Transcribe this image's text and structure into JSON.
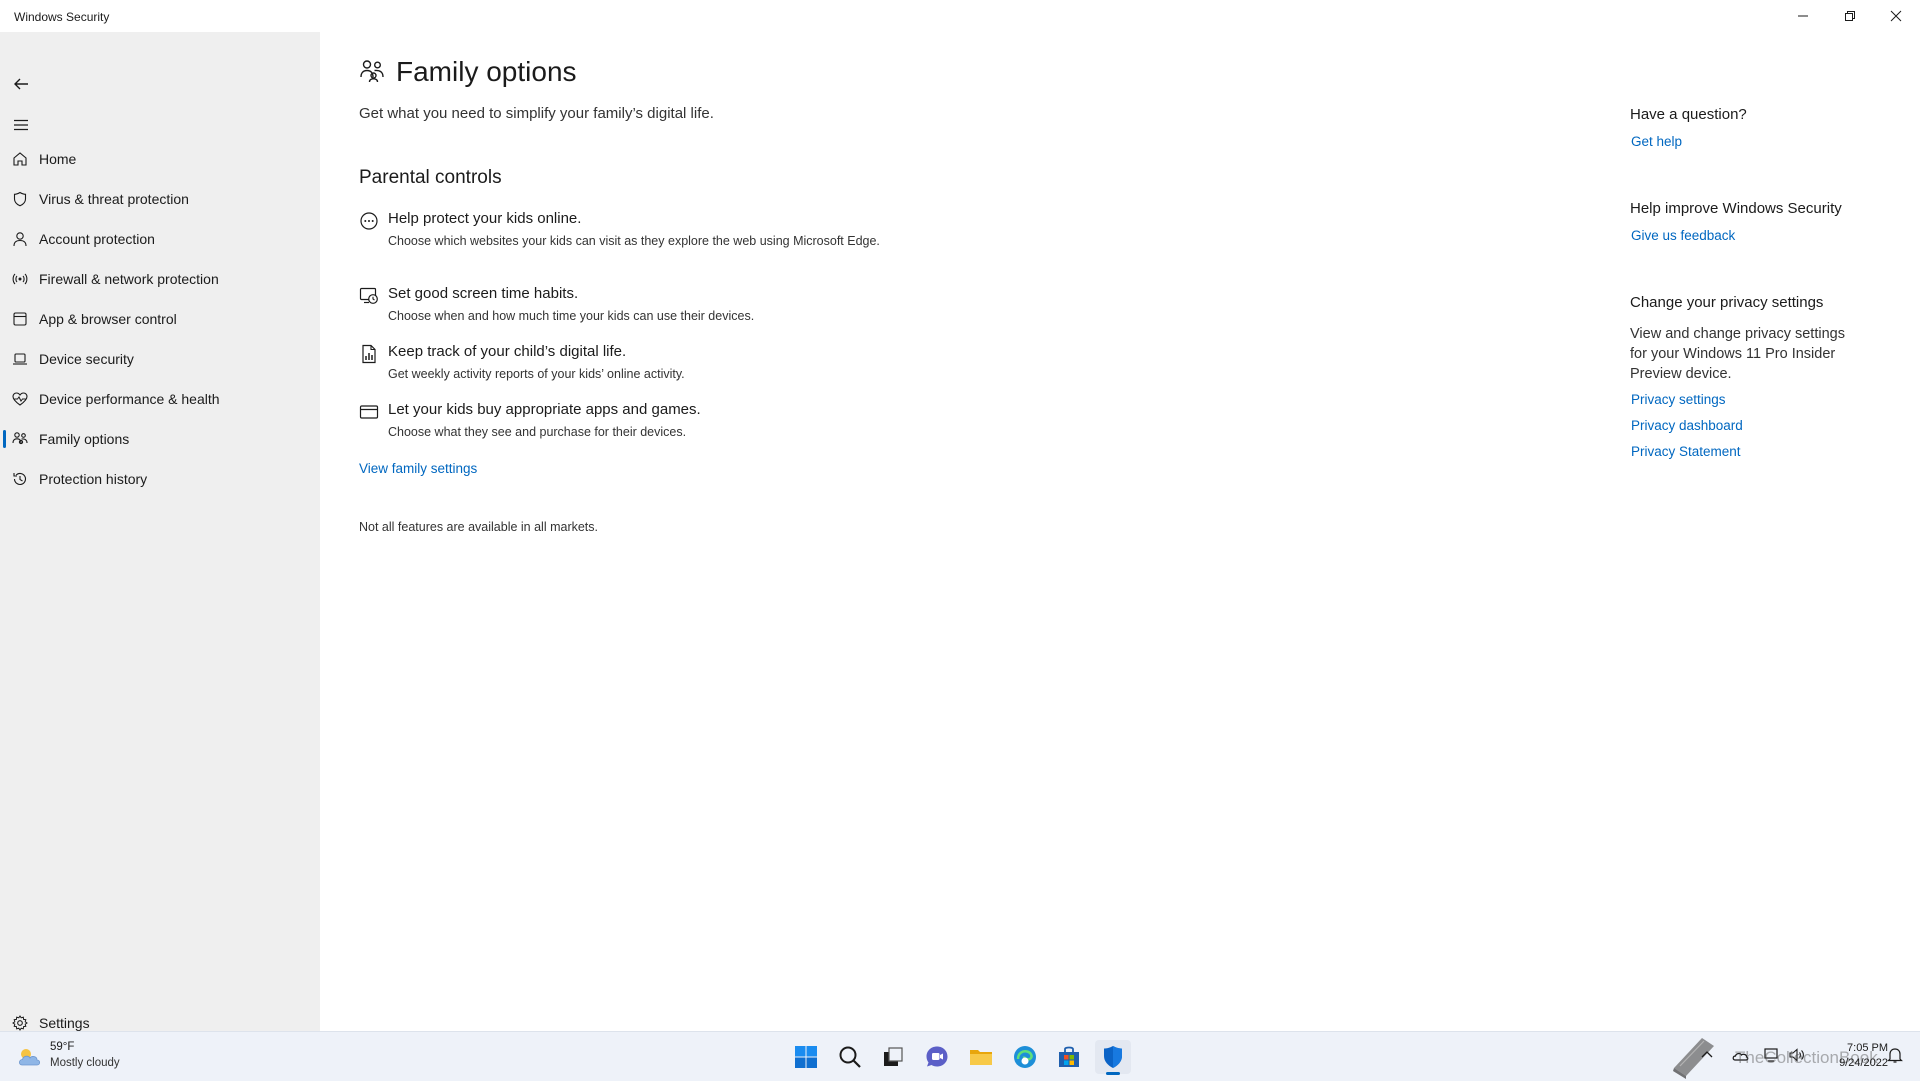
{
  "window": {
    "title": "Windows Security"
  },
  "sidebar": {
    "items": [
      {
        "label": "Home",
        "icon": "home-icon"
      },
      {
        "label": "Virus & threat protection",
        "icon": "shield-icon"
      },
      {
        "label": "Account protection",
        "icon": "person-icon"
      },
      {
        "label": "Firewall & network protection",
        "icon": "antenna-icon"
      },
      {
        "label": "App & browser control",
        "icon": "app-window-icon"
      },
      {
        "label": "Device security",
        "icon": "laptop-icon"
      },
      {
        "label": "Device performance & health",
        "icon": "heart-pulse-icon"
      },
      {
        "label": "Family options",
        "icon": "family-icon"
      },
      {
        "label": "Protection history",
        "icon": "history-icon"
      }
    ],
    "active_item": "Family options",
    "settings_label": "Settings"
  },
  "main": {
    "title": "Family options",
    "subtitle": "Get what you need to simplify your family’s digital life.",
    "section_title": "Parental controls",
    "features": [
      {
        "title": "Help protect your kids online.",
        "description": "Choose which websites your kids can visit as they explore the web using Microsoft Edge.",
        "icon": "web-filter-icon"
      },
      {
        "title": "Set good screen time habits.",
        "description": "Choose when and how much time your kids can use their devices.",
        "icon": "screen-time-icon"
      },
      {
        "title": "Keep track of your child’s digital life.",
        "description": "Get weekly activity reports of your kids’ online activity.",
        "icon": "activity-report-icon"
      },
      {
        "title": "Let your kids buy appropriate apps and games.",
        "description": "Choose what they see and purchase for their devices.",
        "icon": "card-icon"
      }
    ],
    "view_family_settings": "View family settings",
    "note": "Not all features are available in all markets."
  },
  "right_panel": {
    "question_heading": "Have a question?",
    "get_help": "Get help",
    "improve_heading": "Help improve Windows Security",
    "feedback": "Give us feedback",
    "privacy_heading": "Change your privacy settings",
    "privacy_text": "View and change privacy settings for your Windows 11 Pro Insider Preview device.",
    "privacy_settings": "Privacy settings",
    "privacy_dashboard": "Privacy dashboard",
    "privacy_statement": "Privacy Statement"
  },
  "taskbar": {
    "weather_temp": "59°F",
    "weather_condition": "Mostly cloudy",
    "apps": [
      "start-icon",
      "search-icon",
      "task-view-icon",
      "chat-icon",
      "file-explorer-icon",
      "edge-icon",
      "store-icon",
      "windows-security-icon"
    ],
    "active_app": "windows-security-icon",
    "time": "7:05 PM",
    "date": "9/24/2022",
    "watermark": "TheCollectionBook"
  },
  "colors": {
    "accent": "#0067c0",
    "sidebar_bg": "#efefef",
    "taskbar_bg": "#eef2f9"
  }
}
